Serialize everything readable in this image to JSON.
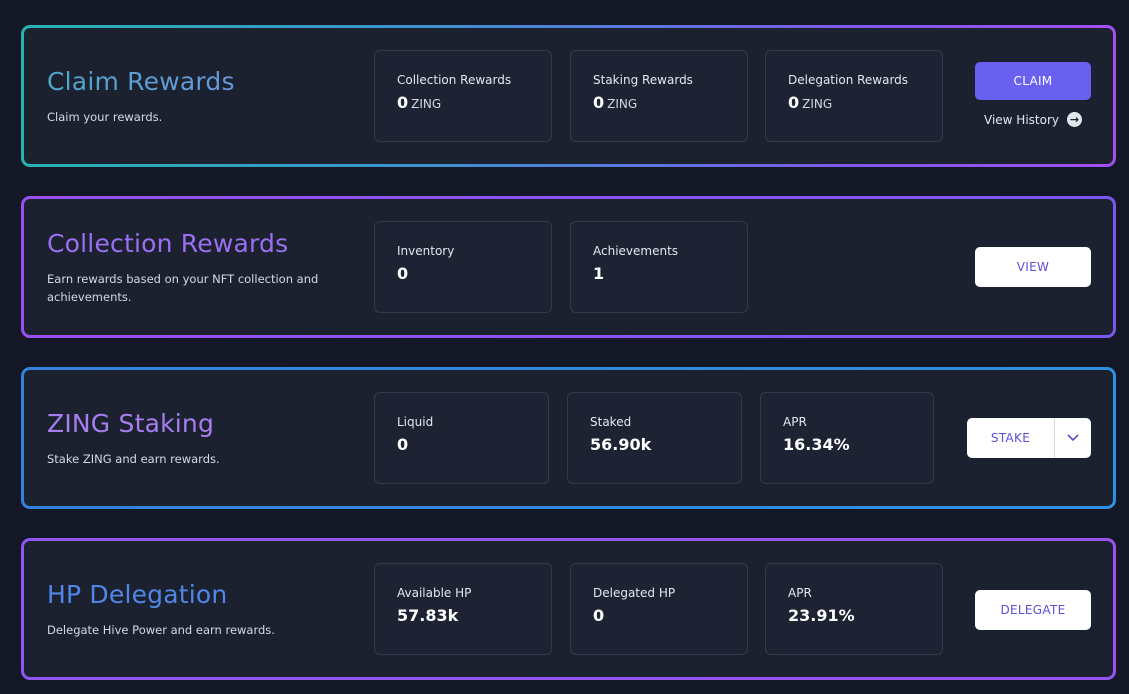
{
  "claim_card": {
    "title": "Claim Rewards",
    "description": "Claim your rewards.",
    "stats": [
      {
        "label": "Collection Rewards",
        "value": "0",
        "unit": "ZING"
      },
      {
        "label": "Staking Rewards",
        "value": "0",
        "unit": "ZING"
      },
      {
        "label": "Delegation Rewards",
        "value": "0",
        "unit": "ZING"
      }
    ],
    "button_label": "CLAIM",
    "history_link": "View History",
    "history_icon": "arrow-right-circle-icon"
  },
  "collection_card": {
    "title": "Collection Rewards",
    "description": "Earn rewards based on your NFT collection and achievements.",
    "stats": [
      {
        "label": "Inventory",
        "value": "0"
      },
      {
        "label": "Achievements",
        "value": "1"
      }
    ],
    "button_label": "VIEW"
  },
  "staking_card": {
    "title": "ZING Staking",
    "description": "Stake ZING and earn rewards.",
    "stats": [
      {
        "label": "Liquid",
        "value": "0"
      },
      {
        "label": "Staked",
        "value": "56.90k"
      },
      {
        "label": "APR",
        "value": "16.34%"
      }
    ],
    "button_label": "STAKE",
    "dropdown_icon": "chevron-down-icon"
  },
  "hp_card": {
    "title": "HP Delegation",
    "description": "Delegate Hive Power and earn rewards.",
    "stats": [
      {
        "label": "Available HP",
        "value": "57.83k"
      },
      {
        "label": "Delegated HP",
        "value": "0"
      },
      {
        "label": "APR",
        "value": "23.91%"
      }
    ],
    "button_label": "DELEGATE"
  },
  "colors": {
    "background": "#141826",
    "card": "#1c2130",
    "accent_button": "#6a60f0",
    "button_text": "#5b4fd8"
  }
}
